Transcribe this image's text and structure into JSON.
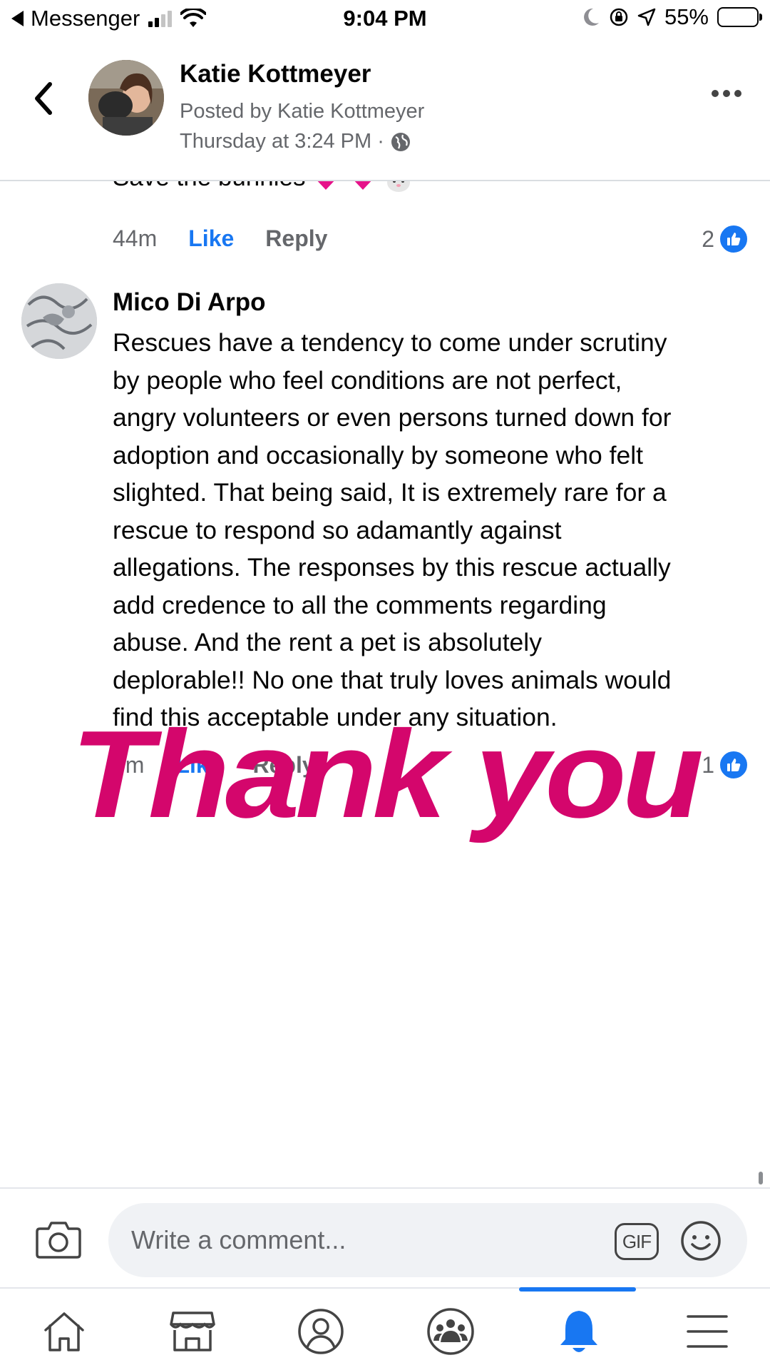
{
  "status_bar": {
    "back_app": "Messenger",
    "time": "9:04 PM",
    "battery": "55%",
    "battery_level": 0.55
  },
  "header": {
    "author": "Katie Kottmeyer",
    "posted_by": "Posted by Katie Kottmeyer",
    "post_time": "Thursday at 3:24 PM ·"
  },
  "previous_comment": {
    "text": "Save the bunnies",
    "time": "44m",
    "like_label": "Like",
    "reply_label": "Reply",
    "like_count": "2"
  },
  "comment": {
    "author": "Mico Di Arpo",
    "lines": [
      "Rescues have a tendency to come under scrutiny",
      "by people who feel conditions are not perfect,",
      "angry volunteers or even persons turned down for",
      "adoption and occasionally by someone who felt",
      "slighted. That being said, It is extremely rare for a",
      "rescue to respond so adamantly against",
      "allegations. The responses by this rescue actually",
      "add credence to all the comments regarding",
      "abuse. And the rent a pet is absolutely",
      "deplorable!! No one that truly loves animals would",
      "find this acceptable under any situation."
    ],
    "time": "9m",
    "like_label": "Like",
    "reply_label": "Reply",
    "like_count": "1"
  },
  "overlay_text": "Thank you",
  "composer": {
    "placeholder": "Write a comment...",
    "gif_label": "GIF"
  },
  "tabs": [
    {
      "icon": "home-icon",
      "active": false
    },
    {
      "icon": "marketplace-icon",
      "active": false
    },
    {
      "icon": "profile-icon",
      "active": false
    },
    {
      "icon": "groups-icon",
      "active": false
    },
    {
      "icon": "notifications-icon",
      "active": true
    },
    {
      "icon": "menu-icon",
      "active": false
    }
  ],
  "colors": {
    "accent": "#1877f2",
    "overlay": "#d4066c",
    "secondary_text": "#65676b"
  }
}
